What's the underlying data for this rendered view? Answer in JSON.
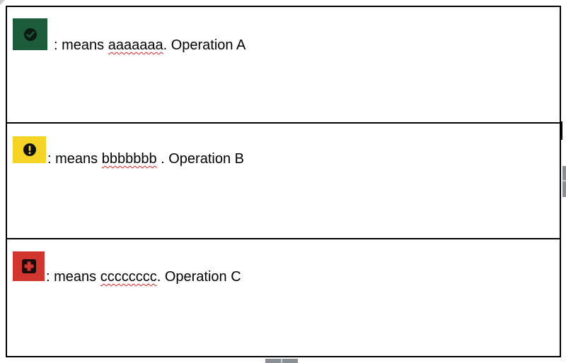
{
  "rows": [
    {
      "icon": "check-circle-icon",
      "icon_bg": "#1d5c3b",
      "prefix": ": means ",
      "code": "aaaaaaa",
      "suffix": ". Operation A"
    },
    {
      "icon": "exclamation-circle-icon",
      "icon_bg": "#f5d327",
      "prefix": ": means ",
      "code": "bbbbbbb",
      "suffix": " . Operation B"
    },
    {
      "icon": "medical-cross-icon",
      "icon_bg": "#d0362d",
      "prefix": ": means ",
      "code": "cccccccc",
      "suffix": ". Operation C"
    }
  ],
  "colors": {
    "border": "#000000",
    "spellcheck": "#dd2222",
    "handle": "#8a8f96"
  }
}
